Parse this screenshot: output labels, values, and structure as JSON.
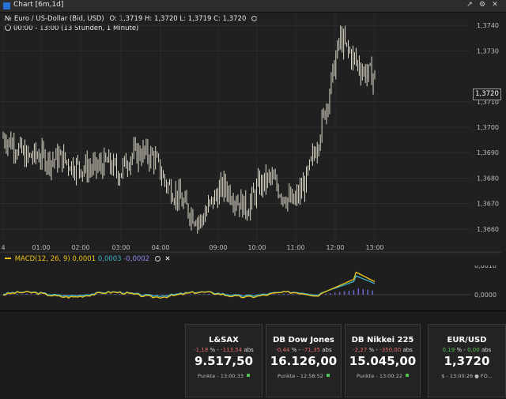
{
  "window": {
    "title": "Chart [6m,1d]"
  },
  "info": {
    "line1_prefix": "№",
    "instrument": "Euro / US-Dollar (Bid, USD)",
    "ohlc": "O: 1,3719  H: 1,3720  L: 1,3719  C: 1,3720",
    "line2": "00:00 - 13:00 (13 Stunden, 1 Minute)"
  },
  "macd_legend": {
    "name": "MACD(12, 26, 9)",
    "v1": "0,0001",
    "v2": "0,0003",
    "v3": "-0,0002"
  },
  "y_axis": [
    "1,3740",
    "1,3730",
    "1,3710",
    "1,3700",
    "1,3690",
    "1,3680",
    "1,3670",
    "1,3660"
  ],
  "macd_axis": [
    "0,0010",
    "0,0000"
  ],
  "price_tag": "1,3720",
  "x_axis": [
    "4",
    "01:00",
    "02:00",
    "03:00",
    "04:00",
    "09:00",
    "10:00",
    "11:00",
    "12:00",
    "13:00"
  ],
  "colors": {
    "candle": "#f2eedc",
    "macd": "#f0c419",
    "signal": "#3bb3c8",
    "hist": "#6a6ad8",
    "up": "#55c155",
    "down": "#e06a6a"
  },
  "tiles": [
    {
      "name": "L&SAX",
      "pct": "-1,18",
      "abs": "-113,54",
      "value": "9.517,50",
      "foot": "Punkte - 13:00:33"
    },
    {
      "name": "DB Dow Jones",
      "pct": "-0,44",
      "abs": "-71,35",
      "value": "16.126,00",
      "foot": "Punkte - 12:58:52"
    },
    {
      "name": "DB Nikkei 225",
      "pct": "-2,27",
      "abs": "-350,00",
      "value": "15.045,00",
      "foot": "Punkte - 13:00:22"
    },
    {
      "name": "EUR/USD",
      "pct": "0,19",
      "abs": "0,00",
      "value": "1,3720",
      "foot": "$ - 13:00:26 ● FO..."
    }
  ],
  "labels": {
    "pct_unit": "%",
    "abs_unit": "abs",
    "sep": "-"
  },
  "chart_data": {
    "type": "line",
    "x": [
      "4",
      "01:00",
      "02:00",
      "03:00",
      "04:00",
      "09:00",
      "10:00",
      "11:00",
      "12:00",
      "13:00"
    ],
    "ylim": [
      1.3655,
      1.3745
    ],
    "series": [
      {
        "values": [
          1.3696,
          1.3693,
          1.3688,
          1.3689,
          1.3687,
          1.3688,
          1.3685,
          1.3684,
          1.3684,
          1.3686,
          1.3682,
          1.3689,
          1.369,
          1.3688,
          1.3678,
          1.3673,
          1.3667,
          1.3663,
          1.3671,
          1.3677,
          1.3672,
          1.3668,
          1.3677,
          1.368,
          1.3674,
          1.367,
          1.3678,
          1.3693,
          1.3712,
          1.3735,
          1.3728,
          1.3722,
          1.372
        ]
      }
    ]
  }
}
